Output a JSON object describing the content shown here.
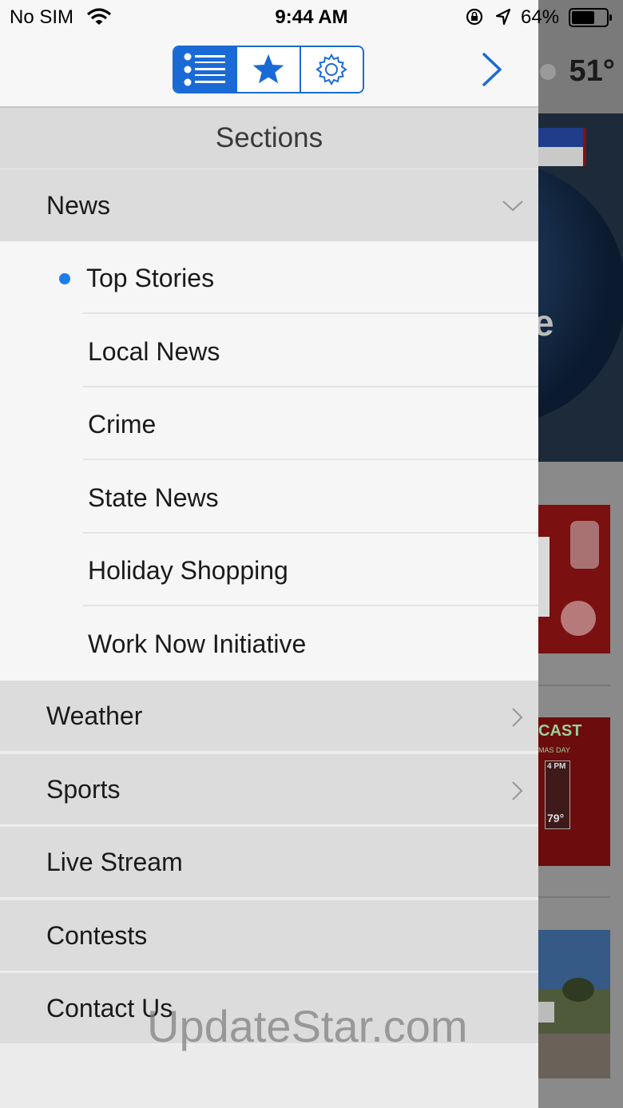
{
  "status_bar": {
    "carrier": "No SIM",
    "time": "9:44 AM",
    "battery_percent": "64%",
    "icons": [
      "wifi-icon",
      "rotation-lock-icon",
      "location-arrow-icon",
      "battery-icon"
    ]
  },
  "header": {
    "segments": [
      {
        "name": "list-icon",
        "selected": true
      },
      {
        "name": "star-icon",
        "selected": false
      },
      {
        "name": "gear-icon",
        "selected": false
      }
    ],
    "accent_color": "#1a6ad6"
  },
  "background": {
    "temperature": "51°",
    "thumb_text": "CAST",
    "thumb_sub": "MAS DAY",
    "thumb_time": "4 PM",
    "thumb_temp": "79°"
  },
  "drawer": {
    "title": "Sections",
    "expanded_group": {
      "label": "News",
      "items": [
        {
          "label": "Top Stories",
          "selected": true
        },
        {
          "label": "Local News"
        },
        {
          "label": "Crime"
        },
        {
          "label": "State News"
        },
        {
          "label": "Holiday Shopping"
        },
        {
          "label": "Work Now Initiative"
        }
      ]
    },
    "groups": [
      {
        "label": "Weather",
        "has_children": true
      },
      {
        "label": "Sports",
        "has_children": true
      },
      {
        "label": "Live Stream",
        "has_children": false
      },
      {
        "label": "Contests",
        "has_children": false
      },
      {
        "label": "Contact Us",
        "has_children": false
      }
    ]
  },
  "watermark": "UpdateStar.com"
}
